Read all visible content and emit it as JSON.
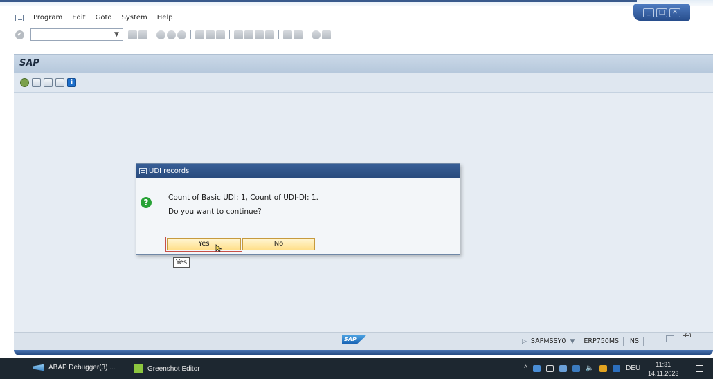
{
  "window": {
    "controls": {
      "minimize": "_",
      "maximize": "□",
      "close": "✕"
    }
  },
  "menubar": {
    "items": [
      "Program",
      "Edit",
      "Goto",
      "System",
      "Help"
    ]
  },
  "toolbar": {
    "command_field_value": "",
    "icons": [
      "enter-icon",
      "save-icon",
      "back-icon",
      "exit-icon",
      "cancel-icon",
      "print-icon",
      "find-icon",
      "find-next-icon",
      "first-page-icon",
      "previous-page-icon",
      "next-page-icon",
      "last-page-icon",
      "new-session-icon",
      "shortcut-icon",
      "help-icon",
      "customize-layout-icon"
    ]
  },
  "titlebar": {
    "title": "SAP"
  },
  "app_toolbar": {
    "icons": [
      "execute-icon",
      "create-icon",
      "display-icon",
      "list-icon",
      "info-icon"
    ],
    "info_glyph": "i"
  },
  "dialog": {
    "title": "UDI records",
    "icon": "question-icon",
    "icon_glyph": "?",
    "message_line1": "Count of Basic UDI: 1, Count of UDI-DI: 1.",
    "message_line2": "Do you want to continue?",
    "yes_label": "Yes",
    "no_label": "No",
    "tooltip": "Yes"
  },
  "statusbar": {
    "logo": "SAP",
    "program": "SAPMSSY0",
    "system": "ERP750MS",
    "mode": "INS"
  },
  "taskbar": {
    "tasks": [
      "ABAP Debugger(3) ...",
      "Greenshot Editor"
    ],
    "language": "DEU",
    "time": "11:31",
    "date": "14.11.2023",
    "tray_chevron": "^",
    "volume_glyph": "🔈"
  }
}
